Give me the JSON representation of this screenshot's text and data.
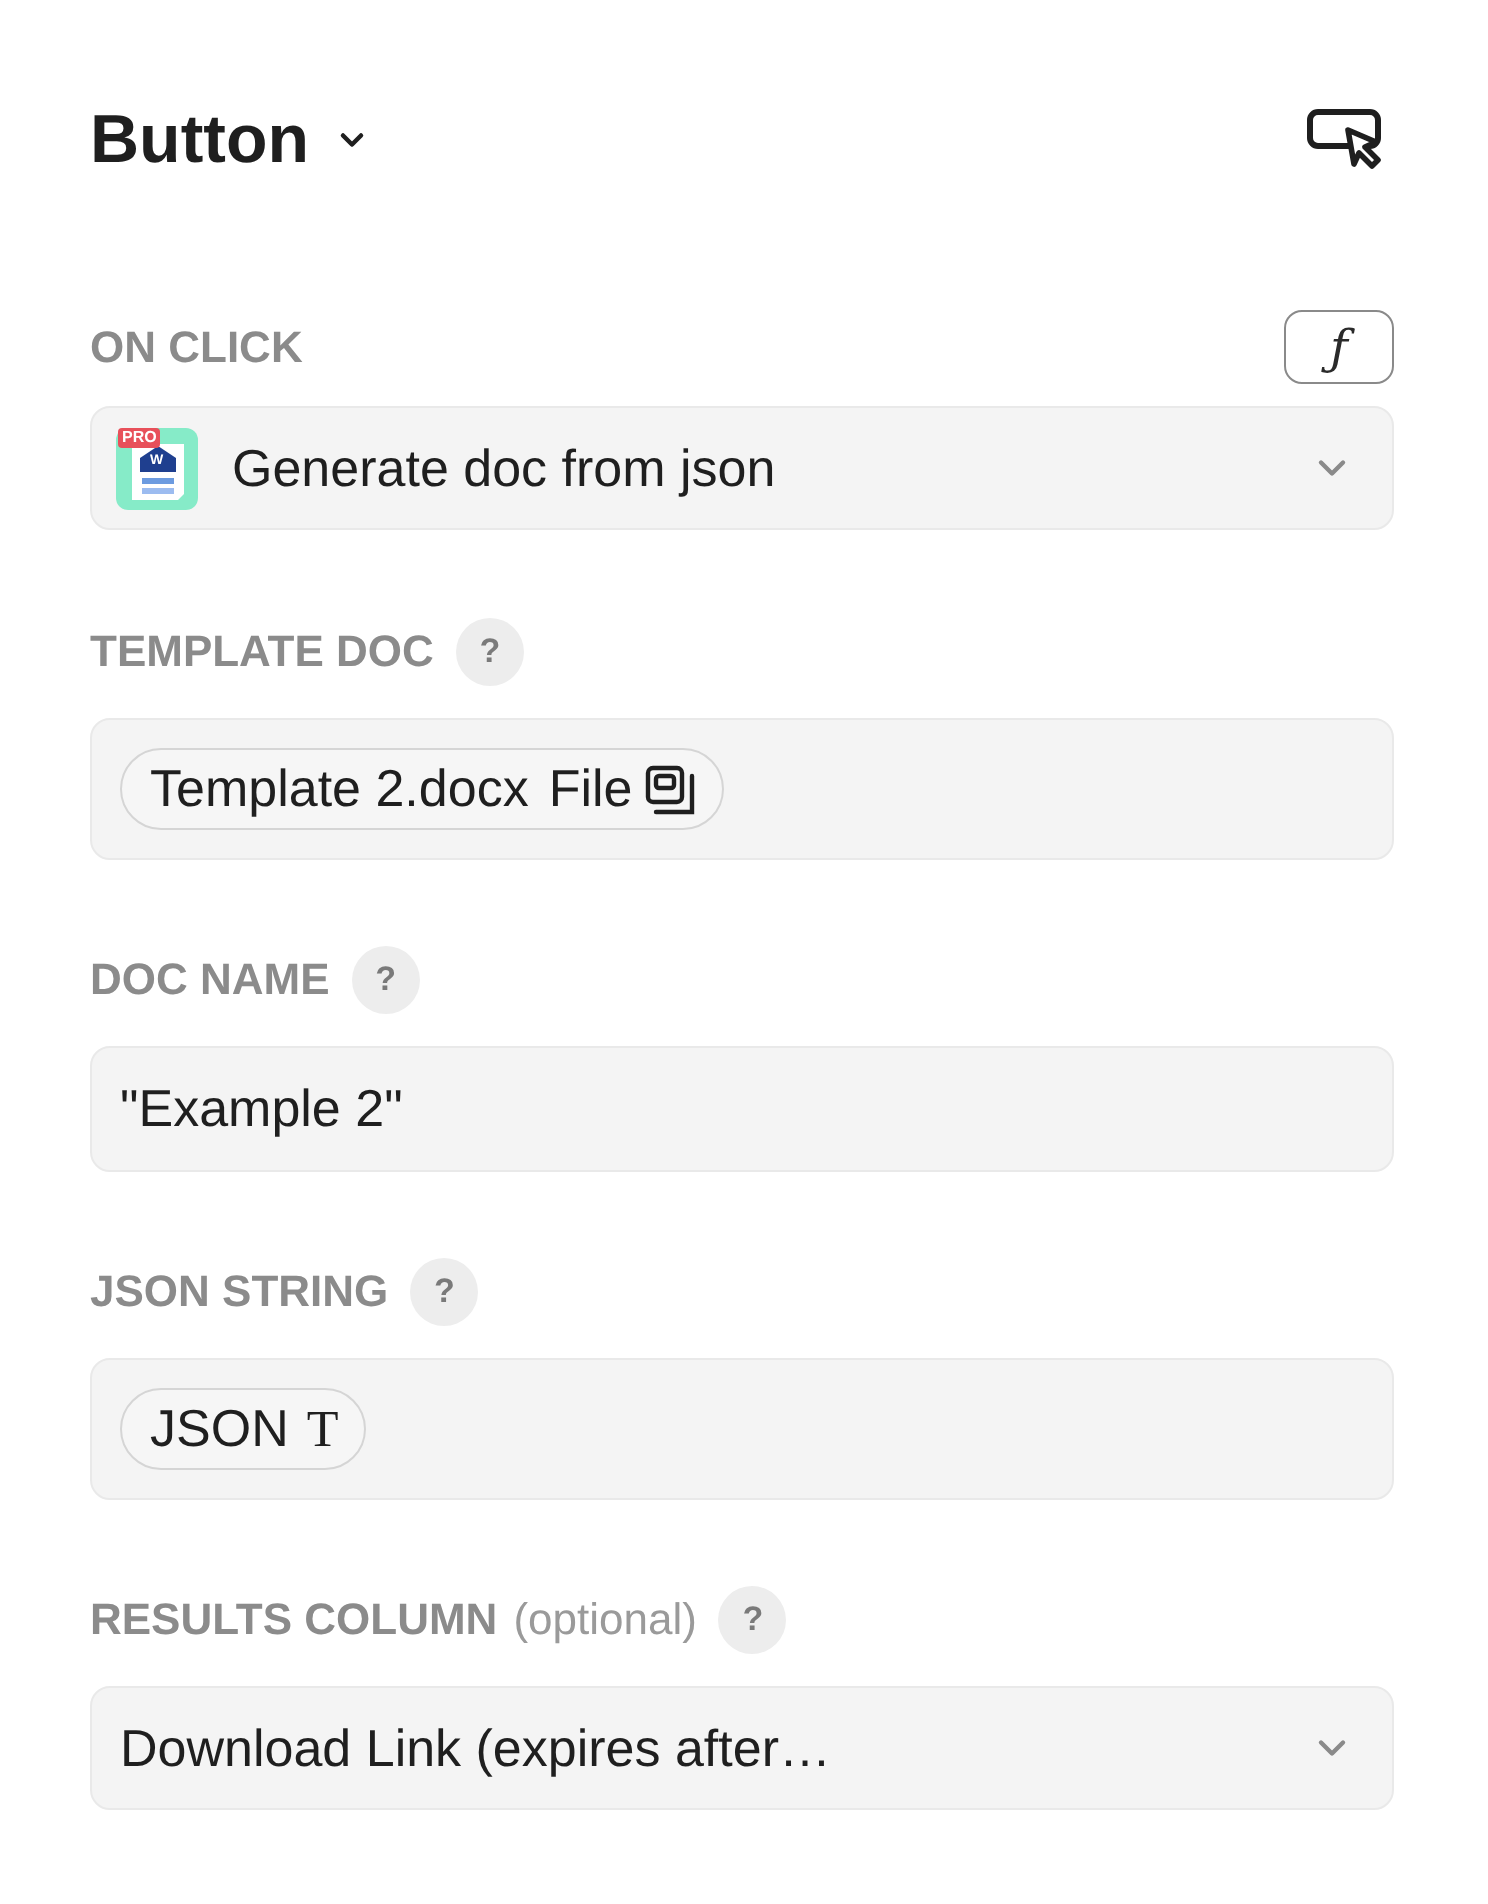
{
  "header": {
    "title": "Button"
  },
  "fields": [
    {
      "kind": "select",
      "label": "ON CLICK",
      "formula_button": "ƒ",
      "logo": {
        "badge": "PRO",
        "letter": "W"
      },
      "value": "Generate doc from json"
    },
    {
      "kind": "chip",
      "label": "TEMPLATE DOC",
      "help": "?",
      "chip": {
        "kind": "file",
        "text": "Template 2.docx",
        "tag": "File"
      }
    },
    {
      "kind": "text",
      "label": "DOC NAME",
      "help": "?",
      "value": "\"Example 2\""
    },
    {
      "kind": "chip",
      "label": "JSON STRING",
      "help": "?",
      "chip": {
        "kind": "text",
        "text": "JSON",
        "tag": "T"
      }
    },
    {
      "kind": "select",
      "label": "RESULTS COLUMN",
      "note": "(optional)",
      "help": "?",
      "value": "Download Link (expires after…"
    }
  ]
}
